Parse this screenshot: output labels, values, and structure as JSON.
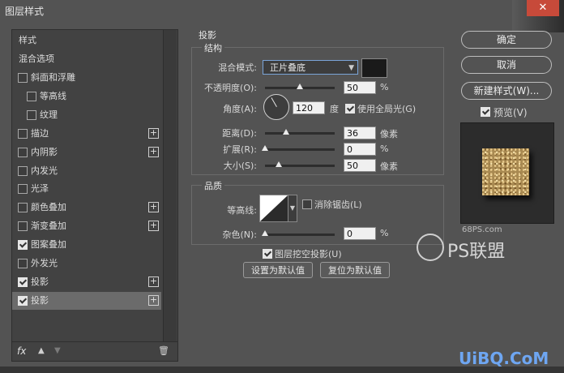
{
  "window": {
    "title": "图层样式",
    "close_label": "✕"
  },
  "left_panel": {
    "header_styles": "样式",
    "header_blend": "混合选项",
    "items": [
      {
        "label": "斜面和浮雕",
        "checked": false,
        "plus": false,
        "indent": false
      },
      {
        "label": "等高线",
        "checked": false,
        "plus": false,
        "indent": true
      },
      {
        "label": "纹理",
        "checked": false,
        "plus": false,
        "indent": true
      },
      {
        "label": "描边",
        "checked": false,
        "plus": true,
        "indent": false
      },
      {
        "label": "内阴影",
        "checked": false,
        "plus": true,
        "indent": false
      },
      {
        "label": "内发光",
        "checked": false,
        "plus": false,
        "indent": false
      },
      {
        "label": "光泽",
        "checked": false,
        "plus": false,
        "indent": false
      },
      {
        "label": "颜色叠加",
        "checked": false,
        "plus": true,
        "indent": false
      },
      {
        "label": "渐变叠加",
        "checked": false,
        "plus": true,
        "indent": false
      },
      {
        "label": "图案叠加",
        "checked": true,
        "plus": false,
        "indent": false
      },
      {
        "label": "外发光",
        "checked": false,
        "plus": false,
        "indent": false
      },
      {
        "label": "投影",
        "checked": true,
        "plus": true,
        "indent": false
      },
      {
        "label": "投影",
        "checked": true,
        "plus": true,
        "indent": false,
        "selected": true
      }
    ],
    "fx_label": "fx",
    "up_icon": "▲",
    "down_icon": "▼",
    "trash_icon": "🗑"
  },
  "drop_shadow": {
    "title": "投影",
    "structure": {
      "legend": "结构",
      "blend_mode_label": "混合模式:",
      "blend_mode_value": "正片叠底",
      "opacity_label": "不透明度(O):",
      "opacity_value": "50",
      "opacity_unit": "%",
      "opacity_level": 0.5,
      "angle_label": "角度(A):",
      "angle_value": "120",
      "angle_unit": "度",
      "global_light_label": "使用全局光(G)",
      "global_light_checked": true,
      "distance_label": "距离(D):",
      "distance_value": "36",
      "distance_unit": "像素",
      "distance_level": 0.3,
      "spread_label": "扩展(R):",
      "spread_value": "0",
      "spread_unit": "%",
      "spread_level": 0,
      "size_label": "大小(S):",
      "size_value": "50",
      "size_unit": "像素",
      "size_level": 0.2,
      "shadow_color": "#1a1a1a"
    },
    "quality": {
      "legend": "品质",
      "contour_label": "等高线:",
      "antialias_label": "消除锯齿(L)",
      "antialias_checked": false,
      "noise_label": "杂色(N):",
      "noise_value": "0",
      "noise_unit": "%",
      "noise_level": 0
    },
    "knockout_label": "图层挖空投影(U)",
    "knockout_checked": true,
    "make_default_label": "设置为默认值",
    "reset_default_label": "复位为默认值"
  },
  "right_panel": {
    "ok_label": "确定",
    "cancel_label": "取消",
    "new_style_label": "新建样式(W)...",
    "preview_label": "预览(V)",
    "preview_checked": true
  },
  "watermark": {
    "site": "68PS.com",
    "logo_text": "PS联盟",
    "bottom_text": "UiBQ.CoM"
  }
}
